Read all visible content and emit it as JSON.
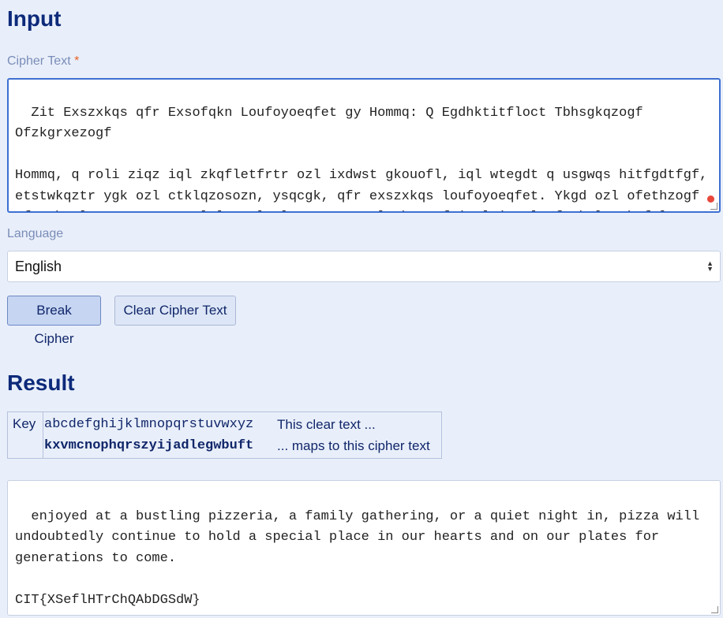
{
  "input": {
    "heading": "Input",
    "cipher_label": "Cipher Text",
    "required_mark": "*",
    "cipher_text": "Zit Exszxkqs qfr Exsofqkn Loufoyoeqfet gy Hommq: Q Egdhktitfloct Tbhsgkqzogf Ofzkgrxezogf\n\nHommq, q roli ziqz iql zkqfletfrtr ozl ixdwst gkouofl, iql wtegdt q usgwqs hitfgdtfgf, etstwkqztr ygk ozl ctklqzosozn, ysqcgk, qfr exszxkqs loufoyoeqfet. Ykgd ozl ofethzogf of Fqhstl, Ozqsn, zg ozl lzqzxl ql q wtsgctr lzqhst of igxltigsrl qfr ktlzqxkqfzl qkgxfr zit ngksr, hommq iql",
    "language_label": "Language",
    "language_value": "English",
    "break_button": "Break Cipher",
    "clear_button": "Clear Cipher Text"
  },
  "result": {
    "heading": "Result",
    "key_label": "Key",
    "clear_alphabet": "abcdefghijklmnopqrstuvwxyz",
    "cipher_alphabet": "kxvmcnophqrszyijadlegwbuft",
    "clear_note": "This clear text ...",
    "cipher_note": "... maps to this cipher text",
    "plain_text": "enjoyed at a bustling pizzeria, a family gathering, or a quiet night in, pizza will undoubtedly continue to hold a special place in our hearts and on our plates for generations to come.\n\nCIT{XSeflHTrChQAbDGSdW}"
  },
  "colors": {
    "background": "#e9effa",
    "heading": "#0d2a7a",
    "label": "#7a8db8",
    "required": "#e8632a",
    "focus_border": "#3d6fd1"
  }
}
